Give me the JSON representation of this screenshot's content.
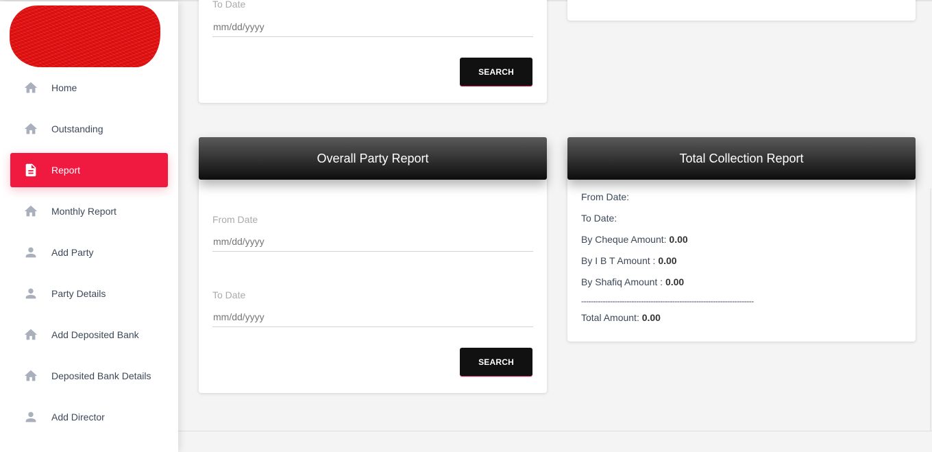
{
  "sidebar": {
    "items": [
      {
        "label": "Home",
        "icon": "home-icon"
      },
      {
        "label": "Outstanding",
        "icon": "home-icon"
      },
      {
        "label": "Report",
        "icon": "document-icon",
        "active": true
      },
      {
        "label": "Monthly Report",
        "icon": "home-icon"
      },
      {
        "label": "Add Party",
        "icon": "person-icon"
      },
      {
        "label": "Party Details",
        "icon": "person-icon"
      },
      {
        "label": "Add Deposited Bank",
        "icon": "home-icon"
      },
      {
        "label": "Deposited Bank Details",
        "icon": "home-icon"
      },
      {
        "label": "Add Director",
        "icon": "person-icon"
      }
    ],
    "active_color": "#f0193f"
  },
  "top_card": {
    "to_date_label": "To Date",
    "to_date_placeholder": "mm/dd/yyyy",
    "search_label": "SEARCH"
  },
  "overall_party_report": {
    "title": "Overall Party Report",
    "from_date_label": "From Date",
    "from_date_placeholder": "mm/dd/yyyy",
    "to_date_label": "To Date",
    "to_date_placeholder": "mm/dd/yyyy",
    "search_label": "SEARCH"
  },
  "total_collection_report": {
    "title": "Total Collection Report",
    "from_date_label": "From Date:",
    "to_date_label": "To Date:",
    "cheque_label": "By Cheque Amount:",
    "cheque_value": "0.00",
    "ibt_label": "By I B T Amount :",
    "ibt_value": "0.00",
    "shafiq_label": "By Shafiq Amount :",
    "shafiq_value": "0.00",
    "separator": "------------------------------------------------------------------------",
    "total_label": "Total Amount:",
    "total_value": "0.00"
  }
}
